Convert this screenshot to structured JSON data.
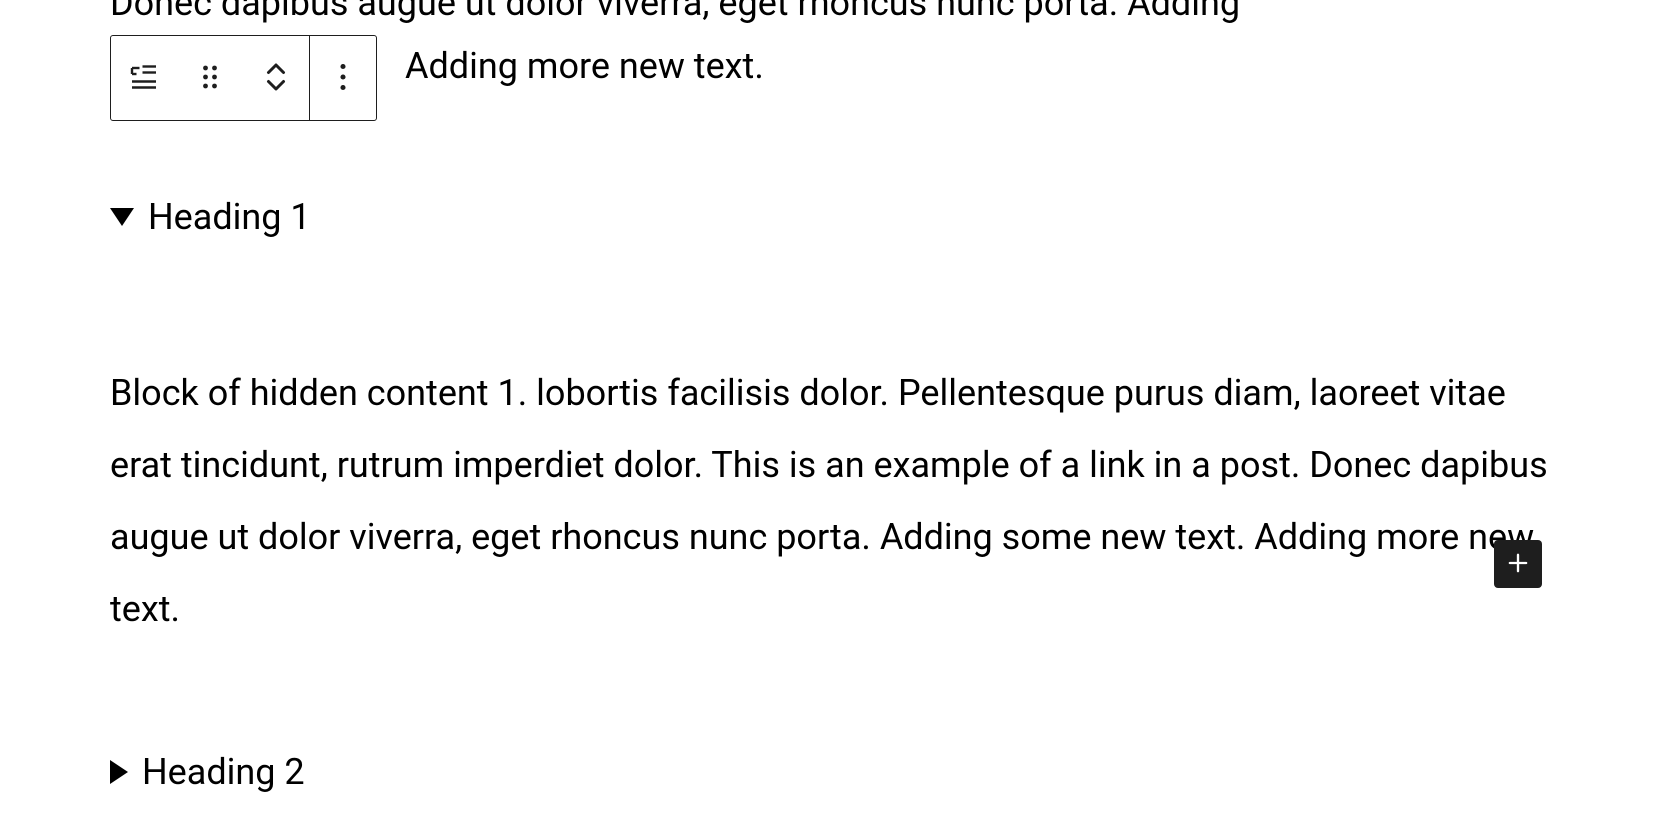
{
  "partialTop": "Donec dapibus augue ut dolor viverra, eget rhoncus nunc porta. Adding",
  "trailing": "Adding more new text.",
  "toolbar": {
    "blockTypeIcon": "details-block-icon",
    "dragIcon": "drag-handle-icon",
    "moveIcon": "move-up-down-icon",
    "moreIcon": "more-options-icon"
  },
  "details1": {
    "summary": "Heading 1",
    "content": "Block of hidden content 1. lobortis facilisis dolor. Pellentesque purus diam, laoreet vitae erat tincidunt, rutrum imperdiet dolor. This is an example of a link in a post. Donec dapibus augue ut dolor viverra, eget rhoncus nunc porta. Adding some new text. Adding more new text."
  },
  "details2": {
    "summary": "Heading 2"
  },
  "addButton": {
    "label": "Add block"
  }
}
